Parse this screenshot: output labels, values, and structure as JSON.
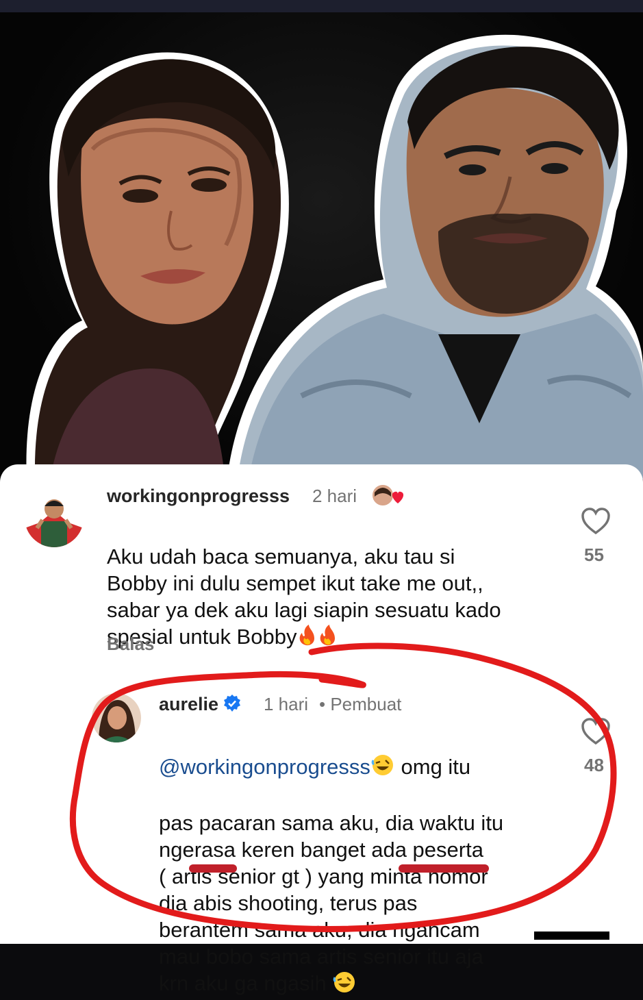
{
  "comments": [
    {
      "username": "workingonprogresss",
      "time": "2 hari",
      "text": "Aku udah baca semuanya, aku tau si\nBobby ini dulu sempet ikut take me out,,\nsabar ya dek aku lagi siapin sesuatu kado\nspesial untuk Bobby",
      "likes": "55",
      "reply_label": "Balas"
    },
    {
      "username": "aurelie",
      "time": "1 hari",
      "creator_label": "• Pembuat",
      "mention": "@workingonprogresss",
      "text_after_mention": " omg itu",
      "text": "pas pacaran sama aku, dia waktu itu\nngerasa keren banget ada peserta\n( artis senior gt ) yang minta nomor\ndia abis shooting, terus pas\nberantem sama aku, dia ngancam\nmau bobo sama artis senior itu aja\nkrn aku ga ngasih",
      "likes": "48"
    }
  ],
  "icons": {
    "heart": "heart-outline-icon",
    "verified": "verified-badge-icon",
    "fire": "fire-emoji",
    "laugh": "rofl-emoji",
    "heart_badge": "creator-liked-heart-icon"
  },
  "colors": {
    "annotation_red": "#e21b1b",
    "redaction": "#c0202a",
    "meta_gray": "#737373"
  }
}
